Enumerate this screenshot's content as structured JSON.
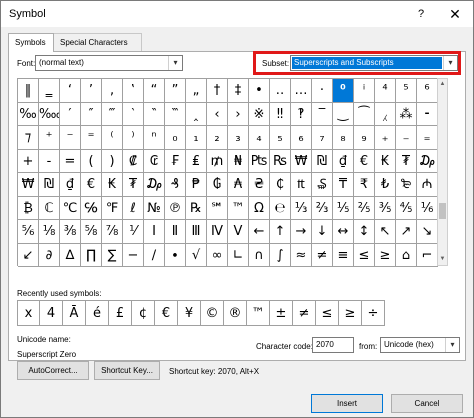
{
  "window": {
    "title": "Symbol",
    "help_glyph": "?",
    "close_glyph": "✕"
  },
  "tabs": [
    {
      "label": "Symbols",
      "active": true
    },
    {
      "label": "Special Characters",
      "active": false
    }
  ],
  "font": {
    "label": "Font:",
    "value": "(normal text)"
  },
  "subset": {
    "label": "Subset:",
    "value": "Superscripts and Subscripts",
    "highlight_color": "#e01818"
  },
  "dropdown_icon": "chevron-down-icon",
  "symbol_grid": {
    "selected_index": 15,
    "rows": [
      [
        "‖",
        "‗",
        "‘",
        "’",
        "‚",
        "‛",
        "“",
        "”",
        "„",
        "†",
        "‡",
        "•",
        "‥",
        "…",
        "‧",
        "⁰",
        "ⁱ",
        "⁴",
        "⁵",
        "⁶"
      ],
      [
        "‰",
        "‱",
        "′",
        "″",
        "‴",
        "‵",
        "‶",
        "‷",
        "‸",
        "‹",
        "›",
        "※",
        "‼",
        "‽",
        "‾",
        "‿",
        "⁀",
        "⁁",
        "⁂",
        "⁃"
      ],
      [
        "⁊",
        "⁺",
        "⁻",
        "⁼",
        "⁽",
        "⁾",
        "ⁿ",
        "₀",
        "₁",
        "₂",
        "₃",
        "₄",
        "₅",
        "₆",
        "₇",
        "₈",
        "₉",
        "₊",
        "₋",
        "₌"
      ],
      [
        "+",
        "-",
        "=",
        "(",
        ")",
        "₡",
        "₢",
        "₣",
        "₤",
        "₥",
        "₦",
        "₧",
        "₨",
        "₩",
        "₪",
        "₫",
        "€",
        "₭",
        "₮",
        "₯"
      ],
      [
        "₩",
        "₪",
        "₫",
        "€",
        "₭",
        "₮",
        "₯",
        "₰",
        "₱",
        "₲",
        "₳",
        "₴",
        "₵",
        "₶",
        "₷",
        "₸",
        "₹",
        "₺",
        "₻",
        "₼"
      ],
      [
        "₿",
        "ℂ",
        "℃",
        "℅",
        "℉",
        "ℓ",
        "№",
        "℗",
        "℞",
        "℠",
        "™",
        "Ω",
        "℮",
        "⅓",
        "⅔",
        "⅕",
        "⅖",
        "⅗",
        "⅘",
        "⅙"
      ],
      [
        "⅚",
        "⅛",
        "⅜",
        "⅝",
        "⅞",
        "⅟",
        "Ⅰ",
        "Ⅱ",
        "Ⅲ",
        "Ⅳ",
        "Ⅴ",
        "←",
        "↑",
        "→",
        "↓",
        "↔",
        "↕",
        "↖",
        "↗",
        "↘"
      ],
      [
        "↙",
        "∂",
        "∆",
        "∏",
        "∑",
        "−",
        "∕",
        "∙",
        "√",
        "∞",
        "∟",
        "∩",
        "∫",
        "≈",
        "≠",
        "≡",
        "≤",
        "≥",
        "⌂",
        "⌐"
      ]
    ]
  },
  "recently_used": {
    "label": "Recently used symbols:",
    "symbols": [
      "x",
      "4",
      "Ā",
      "é",
      "£",
      "¢",
      "€",
      "¥",
      "©",
      "®",
      "™",
      "±",
      "≠",
      "≤",
      "≥",
      "÷"
    ]
  },
  "unicode_name": {
    "label": "Unicode name:",
    "value": "Superscript Zero"
  },
  "character_code": {
    "label": "Character code:",
    "value": "2070"
  },
  "from": {
    "label": "from:",
    "value": "Unicode (hex)"
  },
  "buttons": {
    "autocorrect": "AutoCorrect...",
    "shortcut_key": "Shortcut Key...",
    "insert": "Insert",
    "cancel": "Cancel"
  },
  "shortcut_info": "Shortcut key: 2070, Alt+X"
}
